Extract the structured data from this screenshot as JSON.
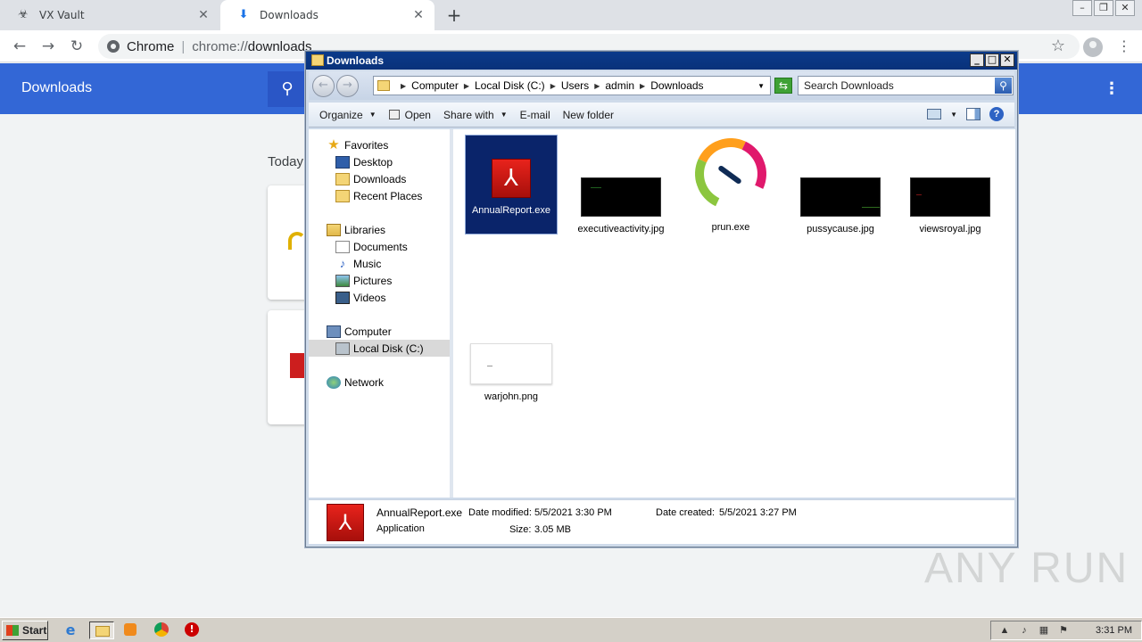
{
  "chrome": {
    "tabs": [
      {
        "title": "VX Vault",
        "icon": "biohazard-icon",
        "active": false
      },
      {
        "title": "Downloads",
        "icon": "download-icon",
        "active": true
      }
    ],
    "omnibox": {
      "site_label": "Chrome",
      "separator": "|",
      "url_scheme": "chrome://",
      "url_host": "downloads"
    }
  },
  "downloads_page": {
    "title": "Downloads",
    "section_label": "Today"
  },
  "explorer": {
    "title": "Downloads",
    "breadcrumbs": [
      "Computer",
      "Local Disk (C:)",
      "Users",
      "admin",
      "Downloads"
    ],
    "search_placeholder": "Search Downloads",
    "commands": {
      "organize": "Organize",
      "open": "Open",
      "share_with": "Share with",
      "email": "E-mail",
      "new_folder": "New folder"
    },
    "nav": {
      "favorites": "Favorites",
      "desktop": "Desktop",
      "downloads": "Downloads",
      "recent_places": "Recent Places",
      "libraries": "Libraries",
      "documents": "Documents",
      "music": "Music",
      "pictures": "Pictures",
      "videos": "Videos",
      "computer": "Computer",
      "local_disk": "Local Disk (C:)",
      "network": "Network"
    },
    "files": [
      {
        "name": "AnnualReport.exe",
        "type": "pdf-app",
        "selected": true
      },
      {
        "name": "executiveactivity.jpg",
        "type": "image",
        "selected": false
      },
      {
        "name": "prun.exe",
        "type": "gauge-app",
        "selected": false
      },
      {
        "name": "pussycause.jpg",
        "type": "image",
        "selected": false
      },
      {
        "name": "viewsroyal.jpg",
        "type": "image",
        "selected": false
      },
      {
        "name": "warjohn.png",
        "type": "png",
        "selected": false
      }
    ],
    "details": {
      "name": "AnnualReport.exe",
      "kind": "Application",
      "modified_label": "Date modified:",
      "modified_value": "5/5/2021 3:30 PM",
      "created_label": "Date created:",
      "created_value": "5/5/2021 3:27 PM",
      "size_label": "Size:",
      "size_value": "3.05 MB"
    }
  },
  "taskbar": {
    "start_label": "Start",
    "clock": "3:31 PM"
  },
  "watermark": "ANY RUN"
}
